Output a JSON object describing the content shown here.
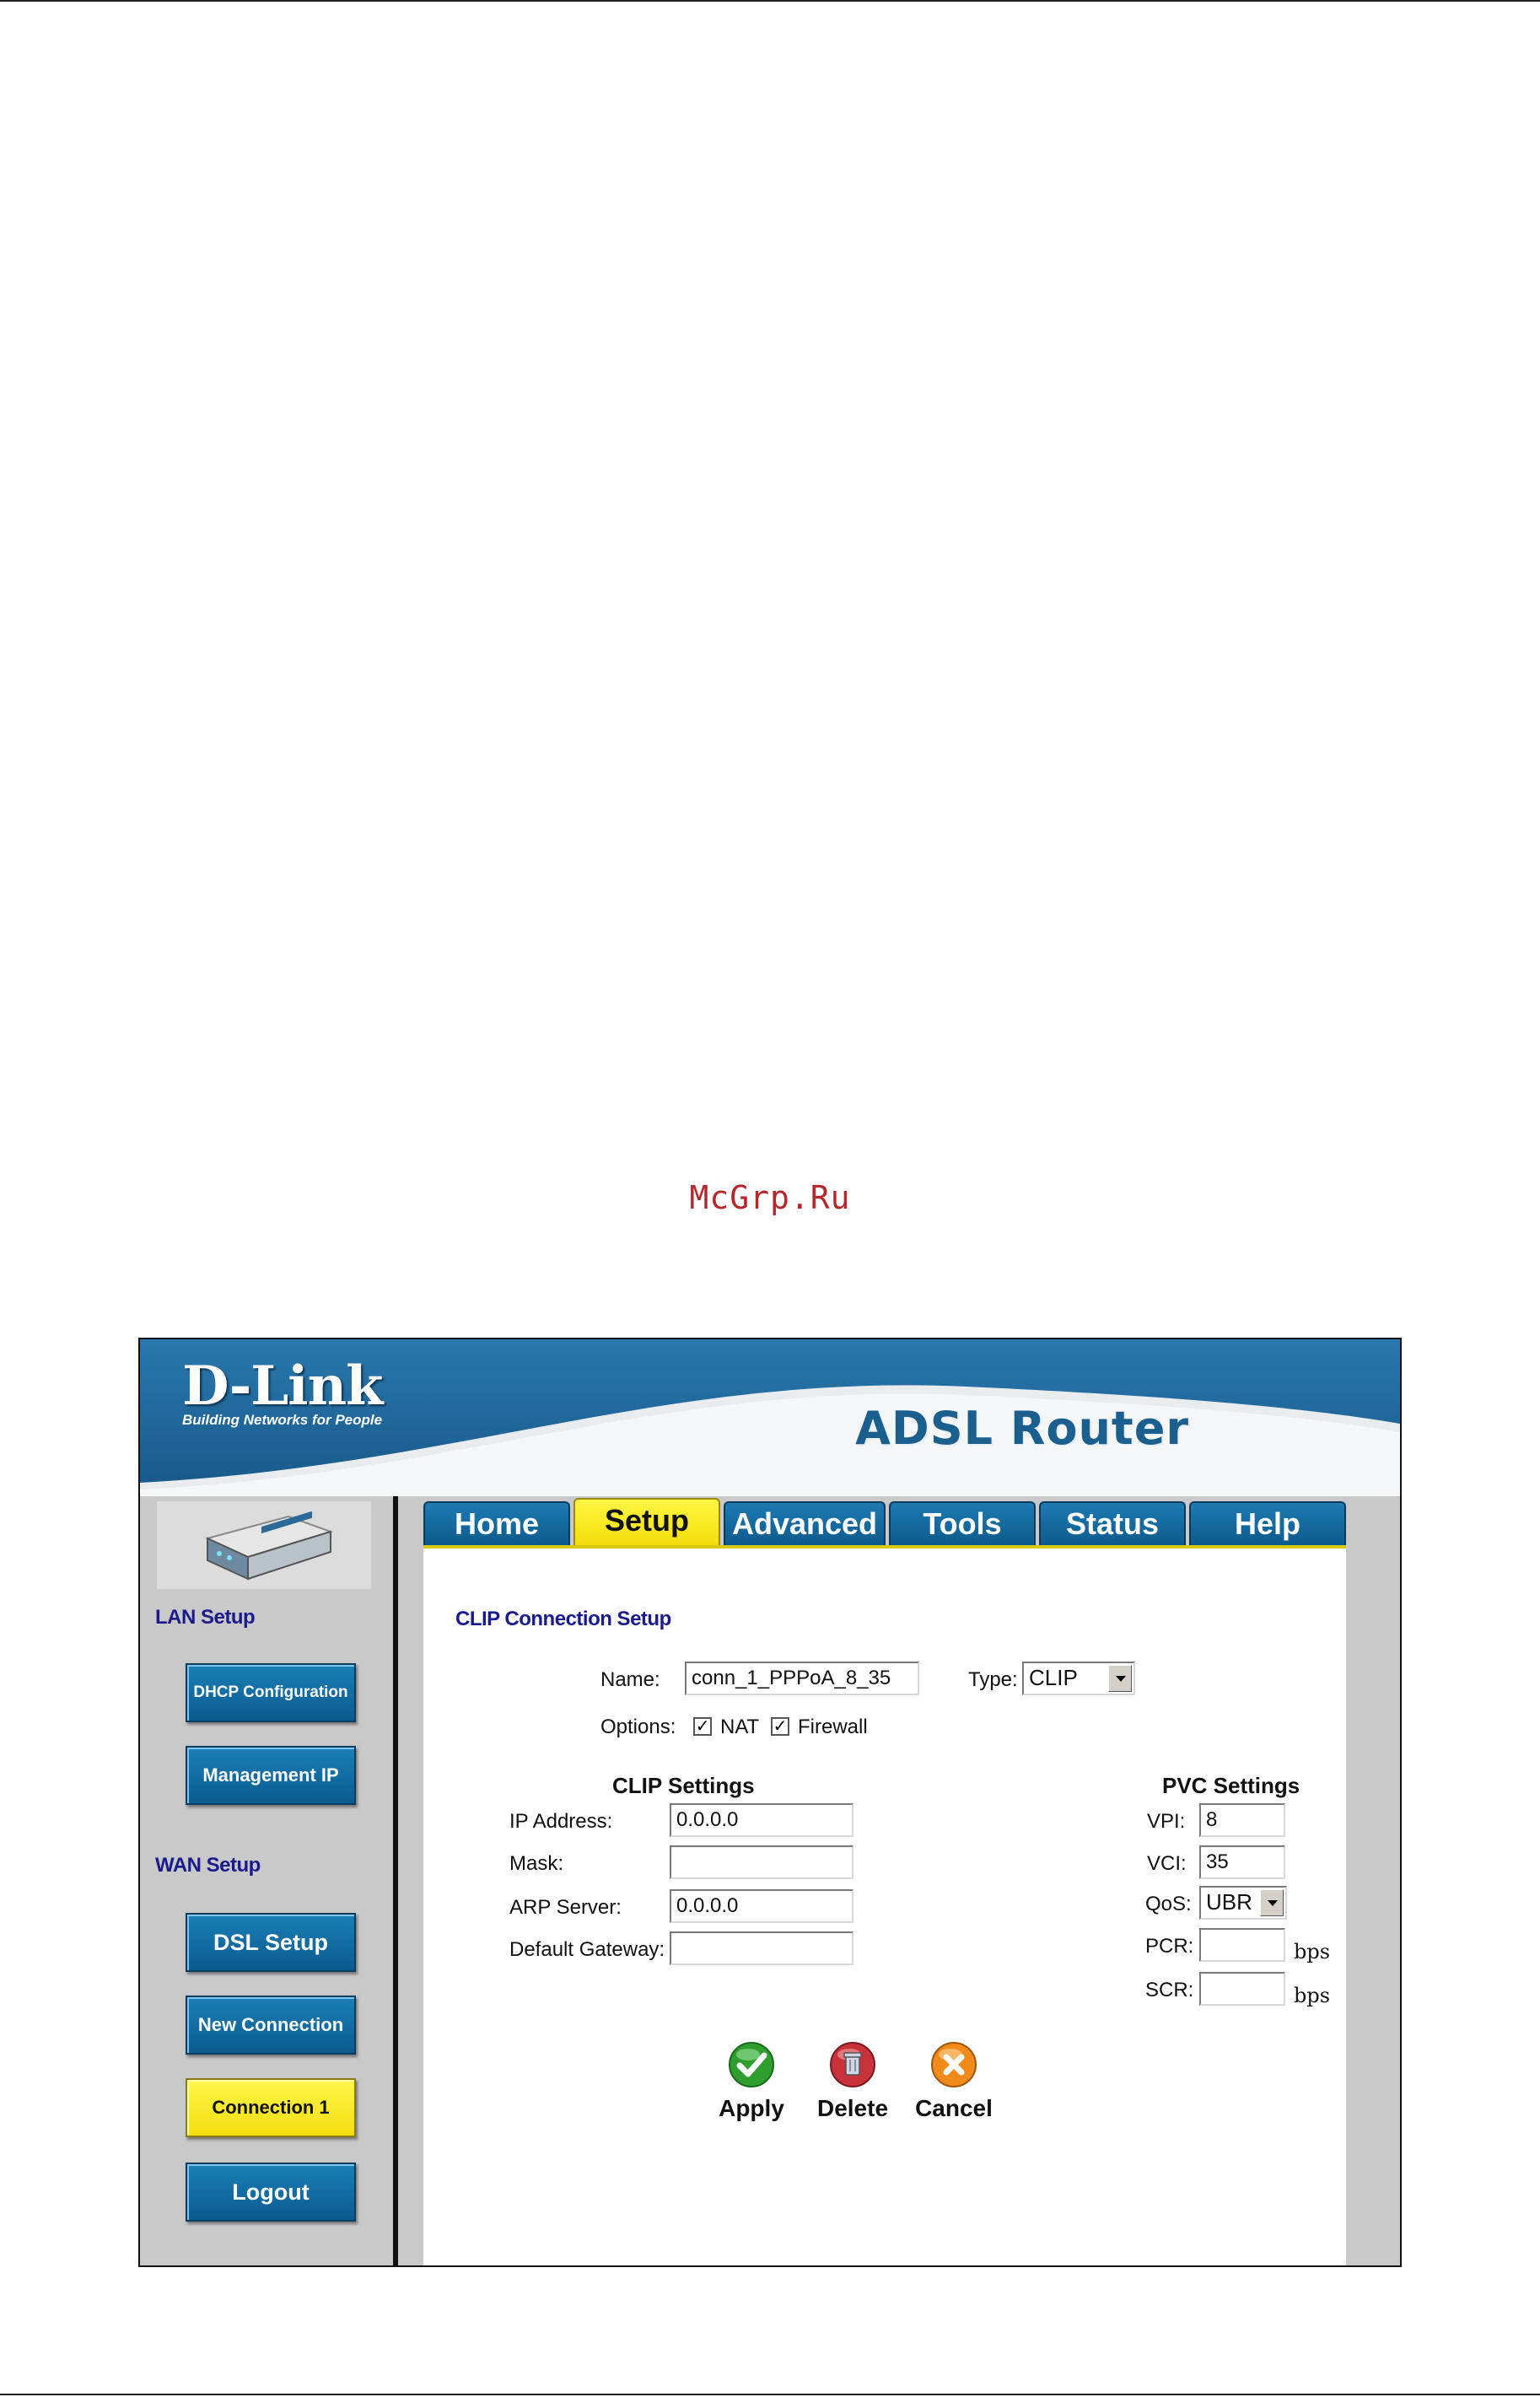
{
  "watermark": "McGrp.Ru",
  "banner": {
    "brand": "D-Link",
    "tagline": "Building Networks for People",
    "product": "ADSL Router"
  },
  "sidebar": {
    "lan_heading": "LAN Setup",
    "wan_heading": "WAN Setup",
    "buttons": {
      "dhcp": "DHCP Configuration",
      "management": "Management IP",
      "dsl": "DSL Setup",
      "new_connection": "New Connection",
      "connection1": "Connection 1",
      "logout": "Logout"
    },
    "active_button": "Connection 1"
  },
  "tabs": [
    {
      "label": "Home"
    },
    {
      "label": "Setup",
      "active": true
    },
    {
      "label": "Advanced"
    },
    {
      "label": "Tools"
    },
    {
      "label": "Status"
    },
    {
      "label": "Help"
    }
  ],
  "form": {
    "title": "CLIP Connection Setup",
    "name_label": "Name:",
    "name_value": "conn_1_PPPoA_8_35",
    "type_label": "Type:",
    "type_value": "CLIP",
    "options_label": "Options:",
    "nat_label": "NAT",
    "nat_checked": true,
    "firewall_label": "Firewall",
    "firewall_checked": true
  },
  "clip_settings": {
    "title": "CLIP Settings",
    "ip_label": "IP Address:",
    "ip_value": "0.0.0.0",
    "mask_label": "Mask:",
    "mask_value": "",
    "arp_label": "ARP Server:",
    "arp_value": "0.0.0.0",
    "gateway_label": "Default Gateway:",
    "gateway_value": ""
  },
  "pvc_settings": {
    "title": "PVC Settings",
    "vpi_label": "VPI:",
    "vpi_value": "8",
    "vci_label": "VCI:",
    "vci_value": "35",
    "qos_label": "QoS:",
    "qos_value": "UBR",
    "pcr_label": "PCR:",
    "pcr_value": "",
    "pcr_unit": "bps",
    "scr_label": "SCR:",
    "scr_value": "",
    "scr_unit": "bps"
  },
  "actions": {
    "apply": "Apply",
    "delete": "Delete",
    "cancel": "Cancel"
  },
  "colors": {
    "banner_blue": "#1f6b9e",
    "tab_blue": "#0d5a8c",
    "active_yellow": "#f4de0a",
    "heading_navy": "#1a1a8c",
    "watermark_red": "#b3282d",
    "apply_green": "#2e9e2e",
    "delete_red": "#c8323a",
    "cancel_orange": "#f08a1a"
  }
}
